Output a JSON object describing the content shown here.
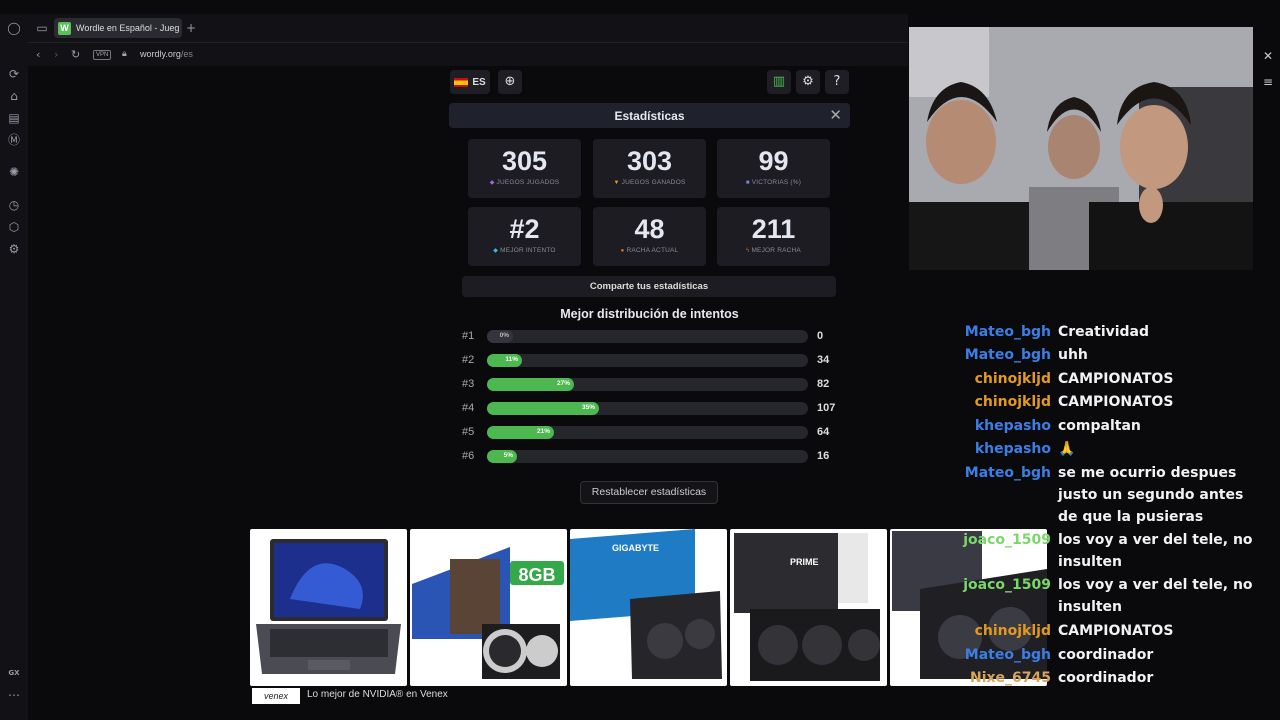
{
  "browser": {
    "tab_title": "Wordle en Español - Jueg",
    "tab_favicon": "W",
    "url_host": "wordly.org",
    "url_path": "/es",
    "vpn_label": "VPN",
    "sidebar_bottom_label": "GX"
  },
  "toolbar": {
    "language": "ES"
  },
  "modal": {
    "title": "Estadísticas",
    "stats": [
      {
        "value": "305",
        "label": "JUEGOS JUGADOS",
        "icon": "controller-icon"
      },
      {
        "value": "303",
        "label": "JUEGOS GANADOS",
        "icon": "trophy-icon"
      },
      {
        "value": "99",
        "label": "VICTORIAS (%)",
        "icon": "chart-icon"
      },
      {
        "value": "#2",
        "label": "MEJOR INTENTO",
        "icon": "diamond-icon"
      },
      {
        "value": "48",
        "label": "RACHA ACTUAL",
        "icon": "fire-icon"
      },
      {
        "value": "211",
        "label": "MEJOR RACHA",
        "icon": "bolt-icon"
      }
    ],
    "share_label": "Comparte tus estadísticas",
    "distribution_title": "Mejor distribución de intentos",
    "reset_label": "Restablecer estadísticas"
  },
  "chart_data": {
    "type": "bar",
    "title": "Mejor distribución de intentos",
    "categories": [
      "#1",
      "#2",
      "#3",
      "#4",
      "#5",
      "#6"
    ],
    "values": [
      0,
      34,
      82,
      107,
      64,
      16
    ],
    "percent_labels": [
      "0%",
      "11%",
      "27%",
      "35%",
      "21%",
      "5%"
    ],
    "percents": [
      0,
      11,
      27,
      35,
      21,
      5
    ],
    "color": "#4cb84f"
  },
  "ad": {
    "logo": "venex",
    "text": "Lo mejor de NVIDIA® en Venex",
    "products": [
      {
        "icon": "laptop-image"
      },
      {
        "icon": "gpu-galax-image",
        "badge": "8GB"
      },
      {
        "icon": "gpu-gigabyte-image",
        "badge": "GIGABYTE"
      },
      {
        "icon": "gpu-asus-image",
        "badge": "PRIME"
      },
      {
        "icon": "gpu-msi-image"
      }
    ]
  },
  "chat": [
    {
      "user": "Mateo_bgh",
      "color": "blue",
      "msg": "Creatividad"
    },
    {
      "user": "Mateo_bgh",
      "color": "blue",
      "msg": "uhh"
    },
    {
      "user": "chinojkljd",
      "color": "orange",
      "msg": "CAMPIONATOS"
    },
    {
      "user": "chinojkljd",
      "color": "orange",
      "msg": "CAMPIONATOS"
    },
    {
      "user": "khepasho",
      "color": "blue",
      "msg": "compaltan"
    },
    {
      "user": "khepasho",
      "color": "blue",
      "msg": "🙏"
    },
    {
      "user": "Mateo_bgh",
      "color": "blue",
      "msg": "se me ocurrio despues justo un segundo antes de que la pusieras"
    },
    {
      "user": "joaco_1509",
      "color": "green",
      "msg": "los voy a ver del tele, no insulten"
    },
    {
      "user": "joaco_1509",
      "color": "green",
      "msg": "los voy a ver del tele, no insulten"
    },
    {
      "user": "chinojkljd",
      "color": "orange",
      "msg": "CAMPIONATOS"
    },
    {
      "user": "Mateo_bgh",
      "color": "blue",
      "msg": "coordinador"
    },
    {
      "user": "Nixe_6745",
      "color": "tan",
      "msg": "coordinador"
    }
  ]
}
